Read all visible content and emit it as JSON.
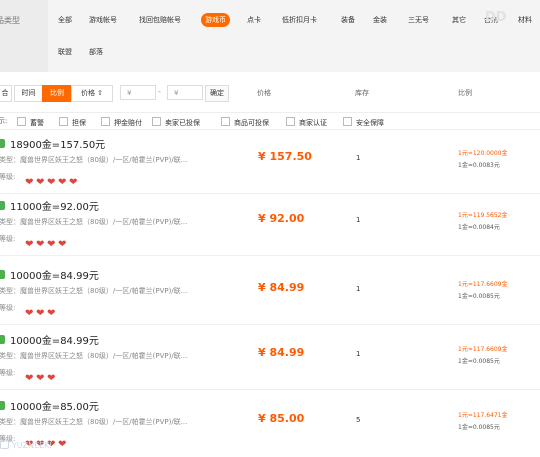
{
  "category": {
    "side_label": "品类型",
    "row1": [
      "全部",
      "游戏帐号",
      "找回包赔帐号",
      "游戏币",
      "点卡",
      "低折扣月卡",
      "装备",
      "金装",
      "三无号",
      "其它",
      "合剂",
      "材料"
    ],
    "row1_active_index": 3,
    "row2": [
      "联盟",
      "部落"
    ],
    "faded_text": "DD"
  },
  "sort": {
    "buttons": [
      "合",
      "时间",
      "比例",
      "价格 ⇧"
    ],
    "active_index": 2,
    "price_min_placeholder": "¥",
    "price_max_placeholder": "¥",
    "dash": "-",
    "confirm_label": "确定",
    "col_price": "价格",
    "col_stock": "库存",
    "col_ratio": "比例"
  },
  "filters": {
    "label": "示:",
    "options": [
      "蓄警",
      "担保",
      "押金赔付",
      "卖家已投保",
      "商品可投保",
      "商家认证",
      "安全保障"
    ]
  },
  "listings": [
    {
      "title": "18900金=157.50元",
      "type_text": "类型：魔兽世界区妖王之怒（80级）/一区/帕霍兰(PVP)/联...",
      "level_label": "等级:",
      "hearts": 5,
      "price": "¥ 157.50",
      "stock": "1",
      "ratio_line1": "1元=120.0000金",
      "ratio_line2": "1金=0.0083元"
    },
    {
      "title": "11000金=92.00元",
      "type_text": "类型：魔兽世界区妖王之怒（80级）/一区/帕霍兰(PVP)/联...",
      "level_label": "等级:",
      "hearts": 4,
      "price": "¥ 92.00",
      "stock": "1",
      "ratio_line1": "1元=119.5652金",
      "ratio_line2": "1金=0.0084元"
    },
    {
      "title": "10000金=84.99元",
      "type_text": "类型：魔兽世界区妖王之怒（80级）/一区/帕霍兰(PVP)/联...",
      "level_label": "等级:",
      "hearts": 3,
      "price": "¥ 84.99",
      "stock": "1",
      "ratio_line1": "1元=117.6609金",
      "ratio_line2": "1金=0.0085元"
    },
    {
      "title": "10000金=84.99元",
      "type_text": "类型：魔兽世界区妖王之怒（80级）/一区/帕霍兰(PVP)/联...",
      "level_label": "等级:",
      "hearts": 3,
      "price": "¥ 84.99",
      "stock": "1",
      "ratio_line1": "1元=117.6609金",
      "ratio_line2": "1金=0.0085元"
    },
    {
      "title": "10000金=85.00元",
      "type_text": "类型：魔兽世界区妖王之怒（80级）/一区/帕霍兰(PVP)/联...",
      "level_label": "等级:",
      "hearts": 4,
      "price": "¥ 85.00",
      "stock": "5",
      "ratio_line1": "1元=117.6471金",
      "ratio_line2": "1金=0.0085元"
    }
  ],
  "watermark": "YUZNEEKI",
  "colors": {
    "accent": "#ff6a00",
    "price": "#ff5a00",
    "heart": "#e0443b",
    "gold_icon": "#4caf50"
  }
}
